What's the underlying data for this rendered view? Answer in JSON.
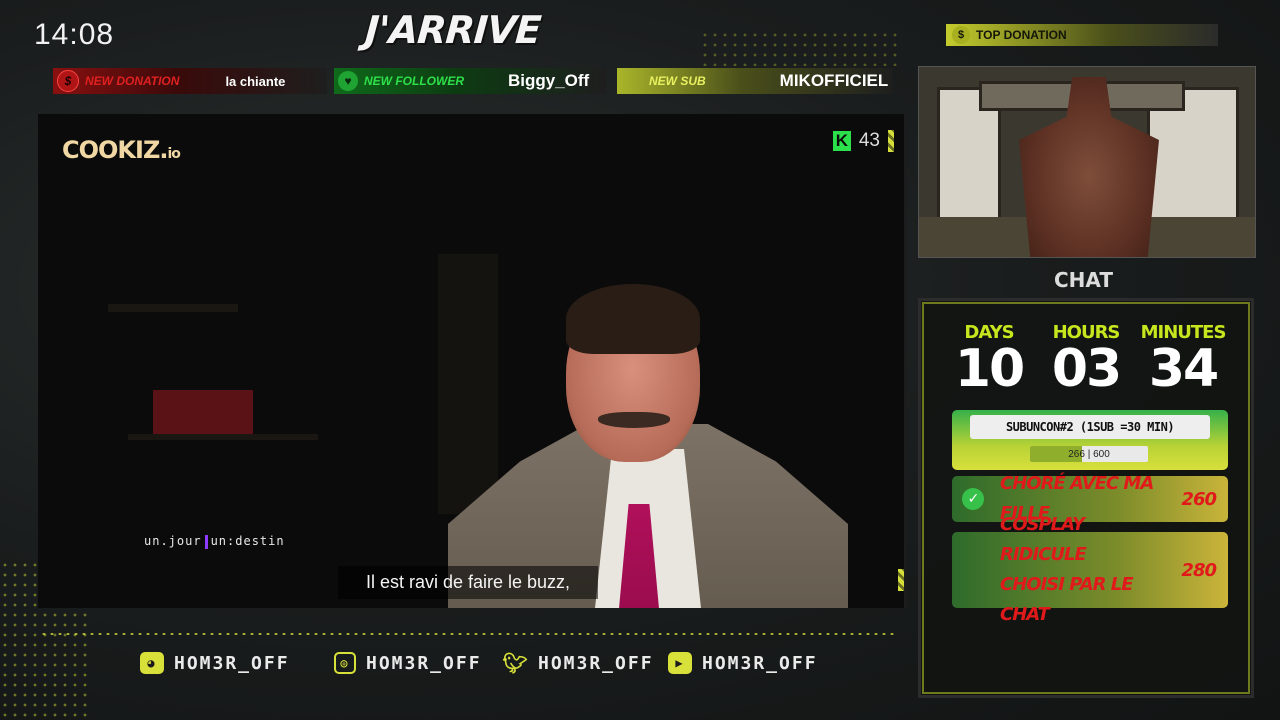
{
  "clock": "14:08",
  "brand": "J'ARRIVE",
  "alerts": [
    {
      "tag": "NEW DONATION",
      "value": "la chiante",
      "icon": "dollar-icon"
    },
    {
      "tag": "NEW FOLLOWER",
      "value": "Biggy_Off",
      "icon": "heart-icon"
    },
    {
      "tag": "NEW SUB",
      "value": "MIKOFFICIEL",
      "icon": ""
    }
  ],
  "video": {
    "logo_main": "COOKIZ.",
    "logo_suffix": "io",
    "viewer_count": "43",
    "show_logo_a": "un.jour",
    "show_logo_b": "un:destin",
    "subtitle": "Il est ravi de faire le buzz,"
  },
  "socials": [
    {
      "icon": "discord-icon",
      "handle": "HOM3R_OFF"
    },
    {
      "icon": "instagram-icon",
      "handle": "HOM3R_OFF"
    },
    {
      "icon": "twitter-icon",
      "handle": "HOM3R_OFF"
    },
    {
      "icon": "youtube-icon",
      "handle": "HOM3R_OFF"
    }
  ],
  "top_donation": {
    "label": "TOP DONATION"
  },
  "chat": {
    "label": "CHAT"
  },
  "timer": {
    "days_label": "DAYS",
    "days": "10",
    "hours_label": "HOURS",
    "hours": "03",
    "minutes_label": "MINUTES",
    "minutes": "34"
  },
  "subathon": {
    "title": "SUBUNCON#2 (1SUB =30 MIN)",
    "current": "266",
    "goal": "600",
    "progress_fraction": 0.44
  },
  "goals": [
    {
      "text": "CHORÉ AVEC MA FILLE",
      "amount": "260",
      "done": true
    },
    {
      "text": "COSPLAY RIDICULE CHOISI PAR LE CHAT",
      "amount": "280",
      "done": false
    }
  ],
  "colors": {
    "accent": "#d8e03a",
    "donation": "#e02020",
    "follower": "#2ee04a",
    "kick": "#2be04a"
  }
}
